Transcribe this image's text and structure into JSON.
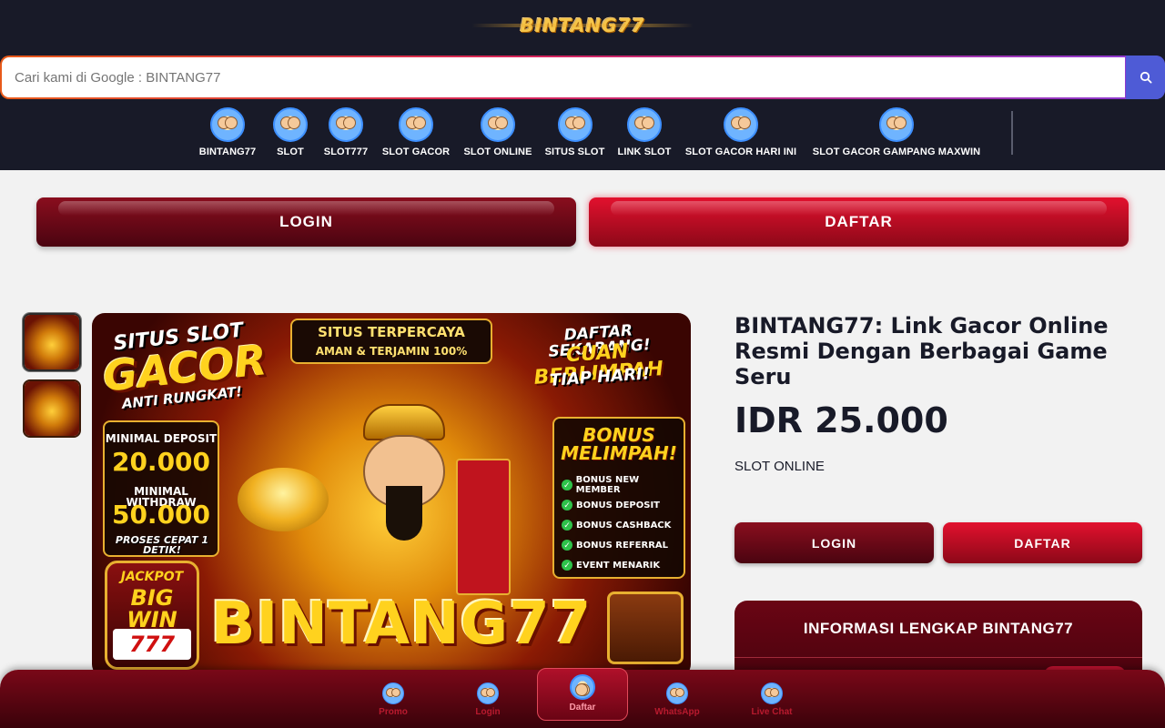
{
  "header": {
    "logo_text": "BINTANG77",
    "search_placeholder": "Cari kami di Google : BINTANG77",
    "search_icon": "search-icon",
    "nav_items": [
      {
        "label": "BINTANG77"
      },
      {
        "label": "SLOT"
      },
      {
        "label": "SLOT777"
      },
      {
        "label": "SLOT GACOR"
      },
      {
        "label": "SLOT ONLINE"
      },
      {
        "label": "SITUS SLOT"
      },
      {
        "label": "LINK SLOT"
      },
      {
        "label": "SLOT GACOR HARI INI"
      },
      {
        "label": "SLOT GACOR GAMPANG MAXWIN"
      }
    ]
  },
  "actions": {
    "login_label": "LOGIN",
    "daftar_label": "DAFTAR"
  },
  "promo": {
    "situs_slot": "SITUS SLOT",
    "gacor": "GACOR",
    "anti_rungkat": "ANTI RUNGKAT!",
    "situs_terpercaya": "SITUS TERPERCAYA",
    "aman": "AMAN & TERJAMIN 100%",
    "daftar_sekarang": "DAFTAR SEKARANG!",
    "cuan": "CUAN BERLIMPAH",
    "tiap_hari": "TIAP HARI!",
    "min_deposit_label": "MINIMAL DEPOSIT",
    "min_deposit_value": "20.000",
    "min_withdraw_label": "MINIMAL WITHDRAW",
    "min_withdraw_value": "50.000",
    "proses": "PROSES CEPAT 1 DETIK!",
    "bonus_title": "BONUS MELIMPAH!",
    "bonus_items": [
      "BONUS NEW MEMBER",
      "BONUS DEPOSIT",
      "BONUS CASHBACK",
      "BONUS REFERRAL",
      "EVENT MENARIK"
    ],
    "jackpot": "JACKPOT",
    "big_win": "BIG WIN",
    "sevens": "777",
    "brand": "BINTANG77"
  },
  "product": {
    "title": "BINTANG77: Link Gacor Online Resmi Dengan Berbagai Game Seru",
    "price": "IDR 25.000",
    "category": "SLOT ONLINE",
    "login_label": "LOGIN",
    "daftar_label": "DAFTAR",
    "info_title": "INFORMASI LENGKAP BINTANG77"
  },
  "bottom_nav": {
    "items": [
      {
        "label": "Promo"
      },
      {
        "label": "Login"
      },
      {
        "label": "Daftar"
      },
      {
        "label": "WhatsApp"
      },
      {
        "label": "Live Chat"
      }
    ]
  },
  "colors": {
    "header_bg": "#181a28",
    "login_btn": "#6a0a18",
    "daftar_btn": "#d60f2a",
    "search_btn": "#4e5bd6"
  }
}
